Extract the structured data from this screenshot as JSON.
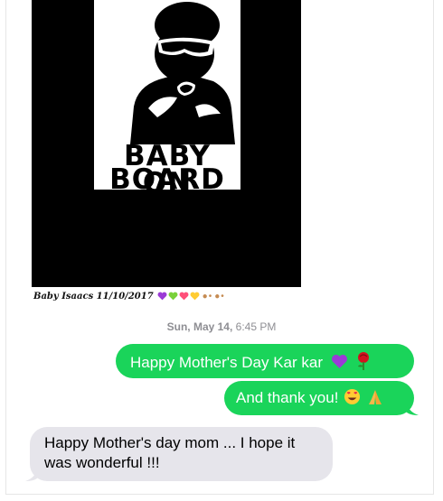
{
  "image": {
    "sticker_line1": "BABY ON",
    "sticker_line2": "BOARD",
    "caption": "Baby Isaacs 11/10/2017",
    "caption_emojis": [
      "purple-heart-icon",
      "green-heart-icon",
      "red-heart-icon",
      "yellow-heart-icon",
      "footprints-icon",
      "footprints-icon"
    ]
  },
  "timestamp": {
    "day": "Sun, May 14,",
    "time": "6:45 PM"
  },
  "messages": [
    {
      "direction": "sent",
      "text": "Happy Mother's Day Kar kar",
      "emojis": [
        "purple-heart-icon",
        "rose-icon"
      ]
    },
    {
      "direction": "sent",
      "text": "And thank you!",
      "emojis": [
        "heart-eyes-icon",
        "praying-hands-icon"
      ]
    },
    {
      "direction": "received",
      "text": "Happy Mother's day mom ... I hope it was wonderful !!!"
    }
  ],
  "colors": {
    "sent_bubble": "#1ad45a",
    "received_bubble": "#e6e5eb",
    "timestamp": "#8e8e93"
  }
}
